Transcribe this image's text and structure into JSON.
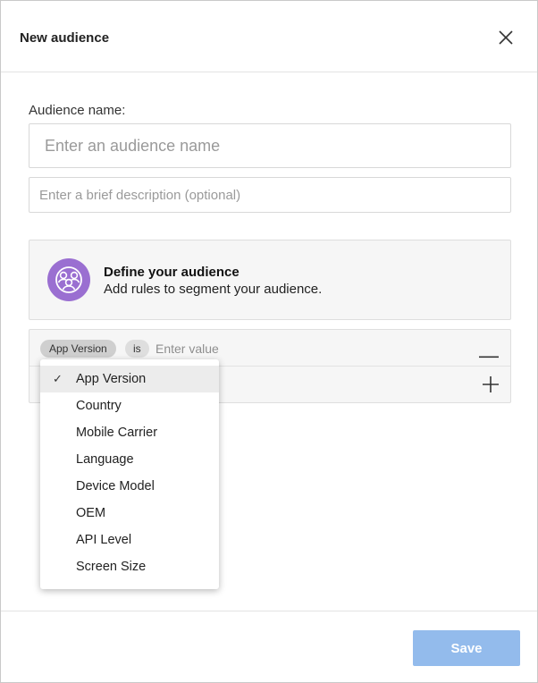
{
  "dialog": {
    "title": "New audience",
    "close_icon": "close-icon"
  },
  "form": {
    "name_label": "Audience name:",
    "name_placeholder": "Enter an audience name",
    "name_value": "",
    "description_placeholder": "Enter a brief description (optional)",
    "description_value": ""
  },
  "define": {
    "icon": "people-group-icon",
    "icon_color": "#9a6fd1",
    "title": "Define your audience",
    "subtitle": "Add rules to segment your audience."
  },
  "rule": {
    "field": "App Version",
    "operator": "is",
    "value_placeholder": "Enter value",
    "value": "",
    "remove_icon": "minus-icon",
    "add_icon": "plus-icon"
  },
  "dropdown": {
    "selected": "App Version",
    "options": [
      "App Version",
      "Country",
      "Mobile Carrier",
      "Language",
      "Device Model",
      "OEM",
      "API Level",
      "Screen Size"
    ]
  },
  "footer": {
    "save_label": "Save",
    "save_color": "#93bbec"
  }
}
